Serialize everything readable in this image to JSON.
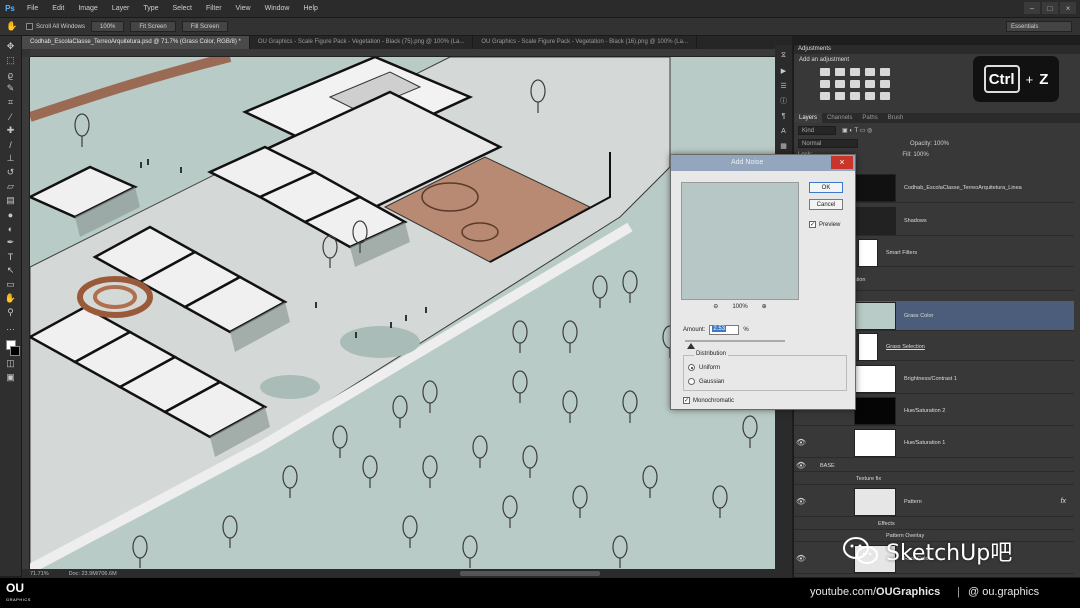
{
  "app": {
    "logo": "Ps",
    "menu": [
      "File",
      "Edit",
      "Image",
      "Layer",
      "Type",
      "Select",
      "Filter",
      "View",
      "Window",
      "Help"
    ]
  },
  "options": {
    "scroll_all_label": "Scroll All Windows",
    "zoom_btn": "100%",
    "fit_btn": "Fit Screen",
    "fill_btn": "Fill Screen",
    "workspace": "Essentials"
  },
  "doc_tabs": [
    "Codhab_EscolaClasse_TerreoArquitetura.psd @ 71.7% (Grass Color, RGB/8) *",
    "OU Graphics - Scale Figure Pack - Vegetation - Black (75).png @ 100% (La...",
    "OU Graphics - Scale Figure Pack - Vegetation - Black (16).png @ 100% (La..."
  ],
  "status": {
    "zoom": "71.71%",
    "doc": "Doc: 23.9M/706.6M"
  },
  "dialog": {
    "title": "Add Noise",
    "ok": "OK",
    "cancel": "Cancel",
    "preview_label": "Preview",
    "zoom_level": "100%",
    "amount_label": "Amount:",
    "amount_value": "2.53",
    "amount_unit": "%",
    "distribution_label": "Distribution",
    "uniform": "Uniform",
    "gaussian": "Gaussian",
    "monochromatic": "Monochromatic"
  },
  "panels": {
    "adjustments_tab": "Adjustments",
    "add_adjustment": "Add an adjustment",
    "layers_tabs": [
      "Layers",
      "Channels",
      "Paths",
      "Brush"
    ],
    "kind": "Kind",
    "blend_mode": "Normal",
    "opacity": "Opacity: 100%",
    "lock": "Lock:",
    "fill": "Fill: 100%",
    "layers": [
      {
        "name": "Codhab_EscolaClasse_TerreoArquitetura_Linea",
        "thumb": "dark"
      },
      {
        "name": "Shadows",
        "thumb": "dark"
      },
      {
        "name": "Smart Filters",
        "thumb": "white"
      },
      {
        "name": "aturation",
        "thumb": "none"
      },
      {
        "name": "Grass Color",
        "thumb": "grass",
        "selected": true
      },
      {
        "name": "Grass Selection",
        "thumb": "white"
      },
      {
        "name": "Brightness/Contrast 1",
        "thumb": "white"
      },
      {
        "name": "Hue/Saturation 2",
        "thumb": "dark"
      },
      {
        "name": "Hue/Saturation 1",
        "thumb": "white"
      },
      {
        "name": "BASE",
        "thumb": "group"
      },
      {
        "name": "Texture fix",
        "thumb": "group"
      },
      {
        "name": "Pattern",
        "thumb": "pattern",
        "fx": "fx"
      },
      {
        "name": "Effects",
        "thumb": "sub"
      },
      {
        "name": "Pattern Overlay",
        "thumb": "sub"
      },
      {
        "name": "Roof Color",
        "thumb": "pattern"
      }
    ]
  },
  "shortcut": {
    "key1": "Ctrl",
    "plus": "+",
    "key2": "Z"
  },
  "watermark": "SketchUp吧",
  "credits": {
    "logo": "OU",
    "logo_sub": "GRAPHICS",
    "youtube_prefix": "youtube.com/",
    "youtube_channel": "OUGraphics",
    "separator": "|",
    "instagram": "@ ou.graphics"
  },
  "colors": {
    "canvas_grass": "#b9cbc6",
    "selected_layer": "#4b5d7a",
    "dialog_title": "#93a6bd",
    "close_red": "#c8362b"
  }
}
